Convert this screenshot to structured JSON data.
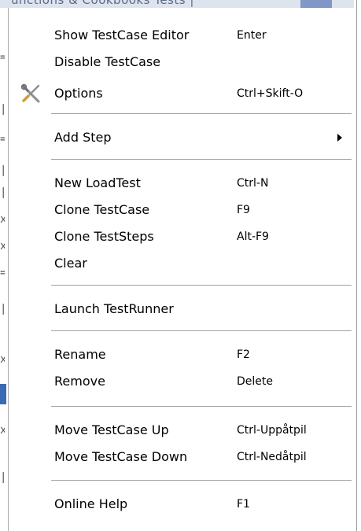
{
  "background": {
    "partial_text": "unctions & Cookbooks  Tests  |"
  },
  "menu": {
    "groups": [
      [
        {
          "label": "Show TestCase Editor",
          "accel": "Enter"
        },
        {
          "label": "Disable TestCase",
          "accel": ""
        },
        {
          "label": "Options",
          "accel": "Ctrl+Skift-O",
          "icon": "tools-icon"
        }
      ],
      [
        {
          "label": "Add Step",
          "accel": "",
          "submenu": true
        }
      ],
      [
        {
          "label": "New LoadTest",
          "accel": "Ctrl-N"
        },
        {
          "label": "Clone TestCase",
          "accel": "F9"
        },
        {
          "label": "Clone TestSteps",
          "accel": "Alt-F9"
        },
        {
          "label": "Clear",
          "accel": ""
        }
      ],
      [
        {
          "label": "Launch TestRunner",
          "accel": ""
        }
      ],
      [
        {
          "label": "Rename",
          "accel": "F2"
        },
        {
          "label": "Remove",
          "accel": "Delete"
        }
      ],
      [
        {
          "label": "Move TestCase Up",
          "accel": "Ctrl-Uppåtpil"
        },
        {
          "label": "Move TestCase Down",
          "accel": "Ctrl-Nedåtpil"
        }
      ],
      [
        {
          "label": "Online Help",
          "accel": "F1"
        }
      ]
    ]
  }
}
